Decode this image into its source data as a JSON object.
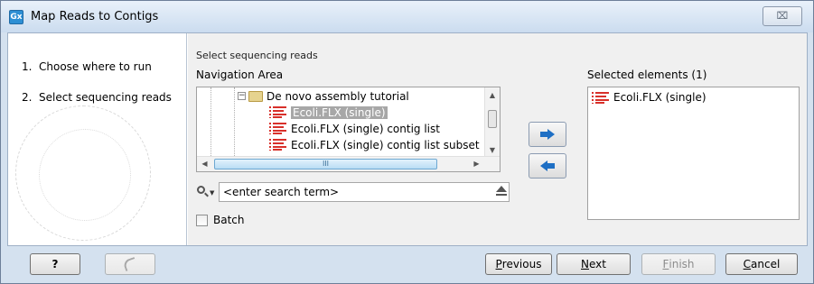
{
  "window": {
    "app_icon_text": "Gx",
    "title": "Map Reads to Contigs",
    "close_glyph": "⌧"
  },
  "steps": [
    {
      "number": "1.",
      "label": "Choose where to run"
    },
    {
      "number": "2.",
      "label": "Select sequencing reads"
    }
  ],
  "main": {
    "section_title": "Select sequencing reads",
    "navigation_label": "Navigation Area",
    "selected_label": "Selected elements (1)",
    "tree": {
      "folder": "De novo assembly tutorial",
      "items": [
        "Ecoli.FLX (single)",
        "Ecoli.FLX (single) contig list",
        "Ecoli.FLX (single) contig list subset"
      ],
      "hscroll_grip": "III"
    },
    "search": {
      "placeholder": "<enter search term>"
    },
    "batch_label": "Batch",
    "selected_items": [
      "Ecoli.FLX (single)"
    ]
  },
  "footer": {
    "help": "?",
    "previous": {
      "mnemonic": "P",
      "rest": "revious"
    },
    "next": {
      "mnemonic": "N",
      "rest": "ext"
    },
    "finish": {
      "mnemonic": "F",
      "rest": "inish"
    },
    "cancel": {
      "mnemonic": "C",
      "rest": "ancel"
    }
  },
  "icons": {
    "app": "gx-app-icon",
    "sequence": "sequence-list-icon",
    "folder": "folder-icon",
    "search": "search-icon",
    "arrow_add": "arrow-right-icon",
    "arrow_remove": "arrow-left-icon"
  },
  "colors": {
    "accent_blue": "#1e6fc4",
    "sequence_red": "#d8302a",
    "selection_gray": "#a7a7a7"
  }
}
